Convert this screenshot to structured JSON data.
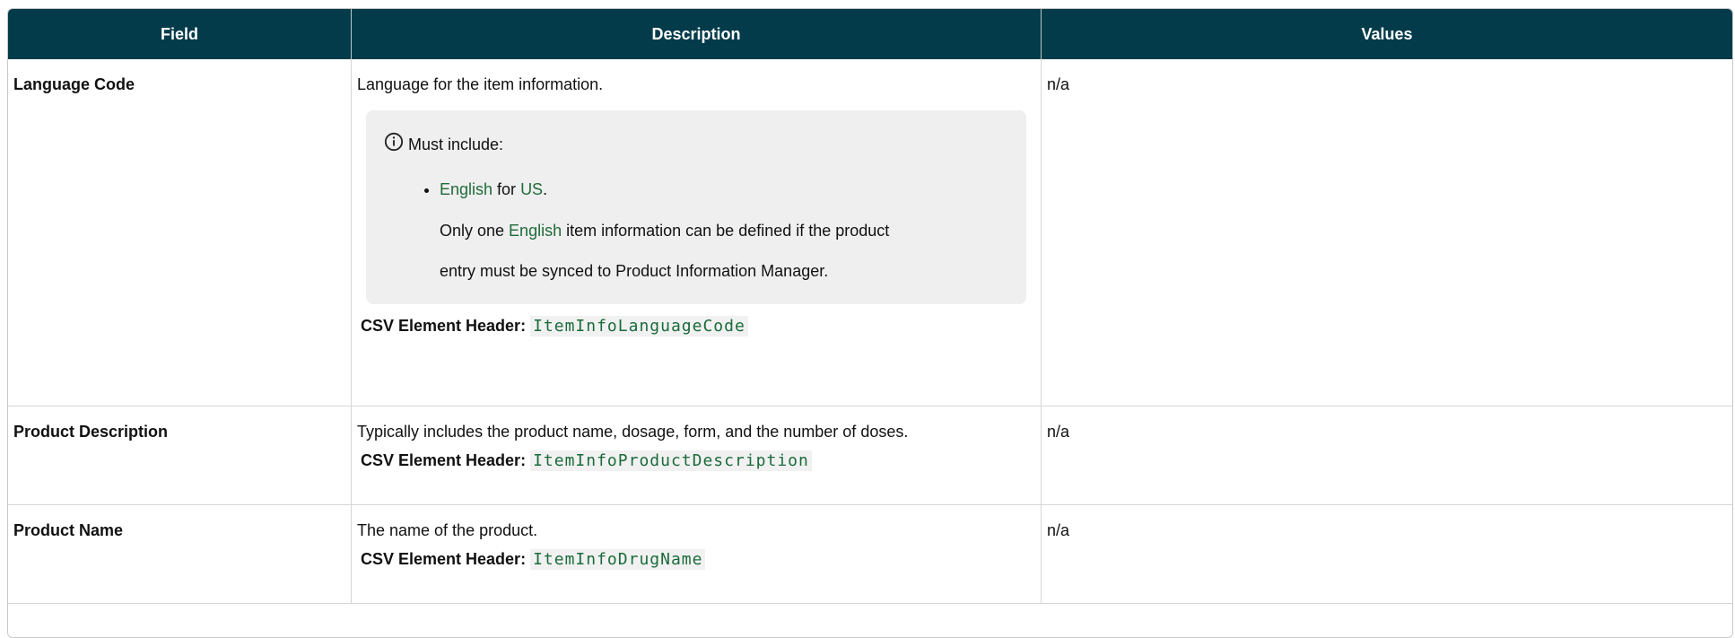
{
  "table": {
    "headers": {
      "field": "Field",
      "description": "Description",
      "values": "Values"
    },
    "rows": [
      {
        "field": "Language Code",
        "description": "Language for the item information.",
        "note": {
          "icon": "info-icon",
          "title": "Must include:",
          "bullet": {
            "lang": "English",
            "for": " for ",
            "country": "US",
            "period": "."
          },
          "sub": {
            "pre": "Only one ",
            "lang": "English",
            "line1_rest": " item information can be defined if the product",
            "line2": "entry must be synced to Product Information Manager."
          }
        },
        "csv_label": "CSV Element Header:",
        "csv_code": "ItemInfoLanguageCode",
        "values": "n/a"
      },
      {
        "field": "Product Description",
        "description": "Typically includes the product name, dosage, form, and the number of doses.",
        "csv_label": "CSV Element Header:",
        "csv_code": "ItemInfoProductDescription",
        "values": "n/a"
      },
      {
        "field": "Product Name",
        "description": "The name of the product.",
        "csv_label": "CSV Element Header:",
        "csv_code": "ItemInfoDrugName",
        "values": "n/a"
      }
    ]
  },
  "colors": {
    "header_bg": "#033b4a",
    "link": "#1f6b3a"
  }
}
